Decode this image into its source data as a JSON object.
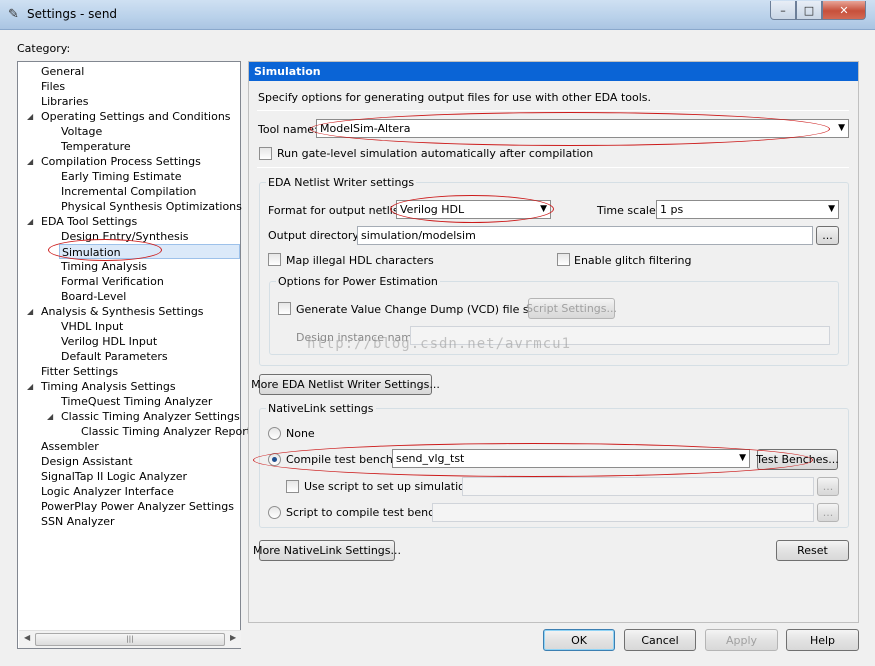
{
  "window": {
    "title": "Settings - send",
    "minimize_glyph": "–",
    "maximize_glyph": "□",
    "close_glyph": "✕"
  },
  "category_label": "Category:",
  "tree": [
    {
      "label": "General",
      "level": 0
    },
    {
      "label": "Files",
      "level": 0
    },
    {
      "label": "Libraries",
      "level": 0
    },
    {
      "label": "Operating Settings and Conditions",
      "level": 0,
      "expanded": true
    },
    {
      "label": "Voltage",
      "level": 1
    },
    {
      "label": "Temperature",
      "level": 1
    },
    {
      "label": "Compilation Process Settings",
      "level": 0,
      "expanded": true
    },
    {
      "label": "Early Timing Estimate",
      "level": 1
    },
    {
      "label": "Incremental Compilation",
      "level": 1
    },
    {
      "label": "Physical Synthesis Optimizations",
      "level": 1
    },
    {
      "label": "EDA Tool Settings",
      "level": 0,
      "expanded": true
    },
    {
      "label": "Design Entry/Synthesis",
      "level": 1
    },
    {
      "label": "Simulation",
      "level": 1,
      "selected": true
    },
    {
      "label": "Timing Analysis",
      "level": 1
    },
    {
      "label": "Formal Verification",
      "level": 1
    },
    {
      "label": "Board-Level",
      "level": 1
    },
    {
      "label": "Analysis & Synthesis Settings",
      "level": 0,
      "expanded": true
    },
    {
      "label": "VHDL Input",
      "level": 1
    },
    {
      "label": "Verilog HDL Input",
      "level": 1
    },
    {
      "label": "Default Parameters",
      "level": 1
    },
    {
      "label": "Fitter Settings",
      "level": 0
    },
    {
      "label": "Timing Analysis Settings",
      "level": 0,
      "expanded": true
    },
    {
      "label": "TimeQuest Timing Analyzer",
      "level": 1
    },
    {
      "label": "Classic Timing Analyzer Settings",
      "level": 1,
      "expanded": true
    },
    {
      "label": "Classic Timing Analyzer Reporting",
      "level": 2
    },
    {
      "label": "Assembler",
      "level": 0
    },
    {
      "label": "Design Assistant",
      "level": 0
    },
    {
      "label": "SignalTap II Logic Analyzer",
      "level": 0
    },
    {
      "label": "Logic Analyzer Interface",
      "level": 0
    },
    {
      "label": "PowerPlay Power Analyzer Settings",
      "level": 0
    },
    {
      "label": "SSN Analyzer",
      "level": 0
    }
  ],
  "panel": {
    "heading": "Simulation",
    "description": "Specify options for generating output files for use with other EDA tools.",
    "tool_name_label": "Tool name:",
    "tool_name_value": "ModelSim-Altera",
    "gate_level_label": "Run gate-level simulation automatically after compilation",
    "netlist_group_title": "EDA Netlist Writer settings",
    "format_label": "Format for output netlist:",
    "format_value": "Verilog HDL",
    "timescale_label": "Time scale:",
    "timescale_value": "1 ps",
    "output_dir_label": "Output directory:",
    "output_dir_value": "simulation/modelsim",
    "browse_label": "...",
    "map_illegal_label": "Map illegal HDL characters",
    "glitch_label": "Enable glitch filtering",
    "power_group_title": "Options for Power Estimation",
    "vcd_label": "Generate Value Change Dump (VCD) file script",
    "script_settings_label": "Script Settings...",
    "design_instance_label": "Design instance name:",
    "more_eda_label": "More EDA Netlist Writer Settings...",
    "nativelink_group_title": "NativeLink settings",
    "none_label": "None",
    "compile_tb_label": "Compile test bench:",
    "compile_tb_value": "send_vlg_tst",
    "test_benches_label": "Test Benches...",
    "use_script_label": "Use script to set up simulation:",
    "script_compile_label": "Script to compile test bench:",
    "more_nativelink_label": "More NativeLink Settings...",
    "reset_label": "Reset"
  },
  "footer": {
    "ok_label": "OK",
    "cancel_label": "Cancel",
    "apply_label": "Apply",
    "help_label": "Help"
  },
  "watermark": "http://blog.csdn.net/avrmcu1",
  "colors": {
    "header_blue": "#0a64d6",
    "selection": "#dbe9f9",
    "annotation_red": "#cc1b1b"
  }
}
